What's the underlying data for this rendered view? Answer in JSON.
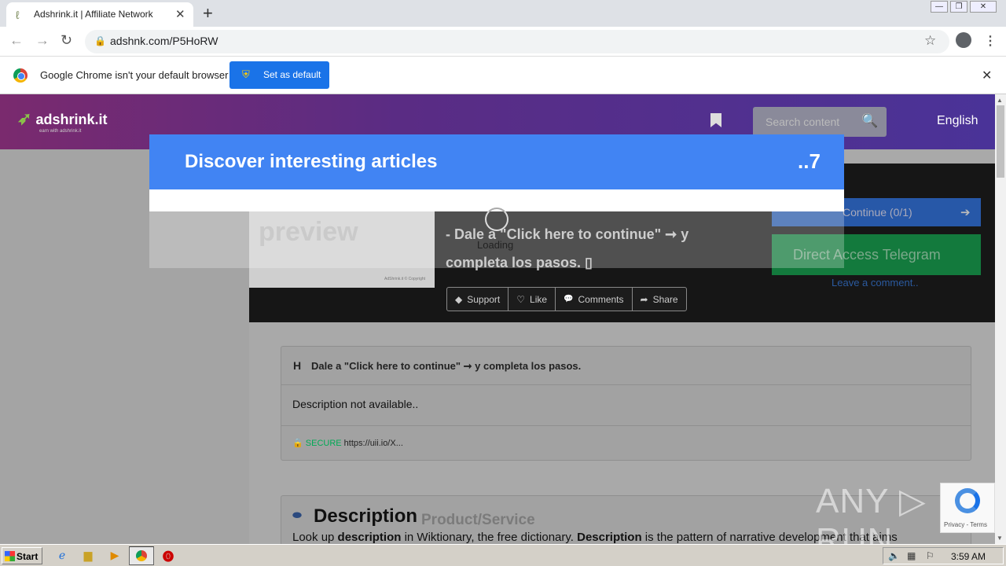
{
  "browser": {
    "tab_title": "Adshrink.it | Affiliate Network",
    "tab_close": "✕",
    "new_tab": "+",
    "url": "adshnk.com/P5HoRW",
    "infobar_text": "Google Chrome isn't your default browser",
    "set_default_label": "Set as default",
    "infobar_close": "✕",
    "win_minimize": "—",
    "win_restore": "❐",
    "win_close": "✕"
  },
  "site": {
    "logo_text": "adshrink.it",
    "logo_tagline": "earn with adshrink.it",
    "search_placeholder": "Search content",
    "language": "English",
    "thumb_watermark": "preview",
    "thumb_caption": "AdShrink.it © Copyright",
    "headline": "- Dale a \"Click here to continue\" ➞ y completa los pasos. ▯",
    "continue_label": "Continue (0/1)",
    "telegram_label": "Direct Access Telegram",
    "leave_comment": "Leave a comment..",
    "actions": [
      {
        "icon": "gem-icon",
        "glyph": "◆",
        "label": "Support"
      },
      {
        "icon": "heart-icon",
        "glyph": "♡",
        "label": "Like"
      },
      {
        "icon": "comments-icon",
        "glyph": "💬",
        "label": "Comments"
      },
      {
        "icon": "share-icon",
        "glyph": "➦",
        "label": "Share"
      }
    ],
    "card1": {
      "heading_icon": "H",
      "heading": "Dale a \"Click here to continue\" ➞ y completa los pasos.",
      "description": "Description not available..",
      "secure_label": "SECURE",
      "secure_url": "https://uii.io/X..."
    },
    "card2": {
      "title": "Description",
      "subtitle": "Product/Service",
      "paragraph_parts": [
        "Look up ",
        "description",
        " in Wiktionary, the free dictionary. ",
        "Description",
        " is the pattern of narrative development that aims"
      ]
    }
  },
  "modal": {
    "title": "Discover interesting articles",
    "countdown": "..7",
    "loading_text": "Loading"
  },
  "overlay": {
    "watermark": "ANY ▷ RUN",
    "recaptcha_text": "Privacy - Terms"
  },
  "taskbar": {
    "start_label": "Start",
    "clock": "3:59 AM"
  },
  "colors": {
    "modal_header": "#4184f3",
    "set_default_button": "#1a73e8",
    "telegram_button": "#137a3d",
    "continue_button": "#2758a8"
  }
}
